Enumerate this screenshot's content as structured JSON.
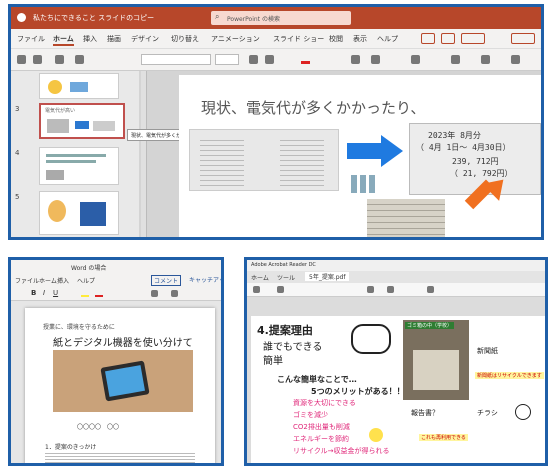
{
  "ppt": {
    "title": "私たちにできること スライドのコピー",
    "search": "PowerPoint の検索",
    "menu": [
      "ファイル",
      "ホーム",
      "挿入",
      "描画",
      "デザイン",
      "切り替え",
      "アニメーション",
      "スライド ショー",
      "校閲",
      "表示",
      "ヘルプ"
    ],
    "slide_numbers": [
      "3",
      "4",
      "5",
      "6"
    ],
    "thumb_caption": "電気代が高い",
    "tooltip": "現状、電気代が多くかかったり、スライド Ico",
    "slide_heading": "現状、電気代が多くかかったり、",
    "bill_lines": [
      "2023年 8月分",
      "（ 4月 1日〜 4月30日）",
      "239, 712円",
      "（ 21, 792円）"
    ],
    "colors": {
      "title_bar": "#b7472a",
      "frame": "#1f5fa8",
      "arrow_blue": "#1f7ae0",
      "arrow_orange": "#f07020"
    }
  },
  "word": {
    "title": "Word の場合",
    "menu": [
      "ファイル",
      "ホーム",
      "挿入",
      "ヘルプ"
    ],
    "comment_button": "コメント",
    "catchup_button": "キャッチアップ",
    "doc_top": "授業に、環境を守るために",
    "doc_title": "紙とデジタル機器を使い分けて",
    "doc_author": "〇〇〇〇　〇〇",
    "doc_section": "1．提案のきっかけ"
  },
  "pdf": {
    "title": "Adobe Acrobat Reader DC",
    "tabs": [
      "ホーム",
      "ツール",
      "5年_提案.pdf"
    ],
    "heading": "4.提案理由",
    "bullets": [
      "誰でもできる",
      "簡単"
    ],
    "promo_title": "こんな簡単なことで…",
    "promo_sub": "5つのメリットがある！！",
    "benefits": [
      "資源を大切にできる",
      "ゴミを減少",
      "CO2排出量も削減",
      "エネルギーを節約",
      "リサイクル→収益金が得られる"
    ],
    "photo_label": "ゴミ箱の中（学校）",
    "label_newspaper": "新聞紙",
    "label_report": "報告書？",
    "label_flyer": "チラシ",
    "note1": "新聞紙はリサイクルできます",
    "note2": "これも再利用できる"
  }
}
